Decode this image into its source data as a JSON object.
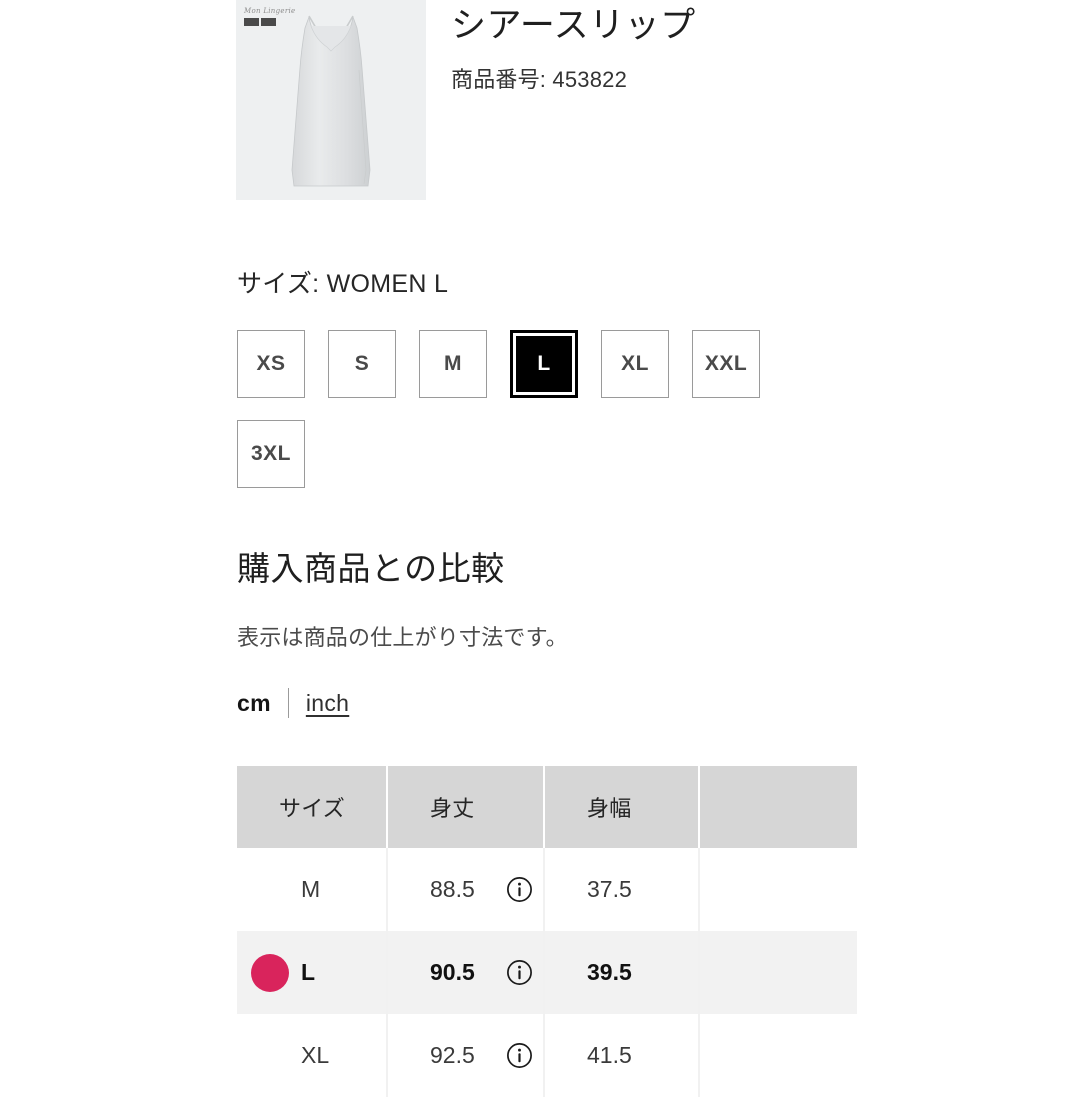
{
  "product": {
    "title": "シアースリップ",
    "code_label": "商品番号: 453822",
    "thumbnail": {
      "watermark_script": "Mon Lingerie",
      "alt": "sheer slip dress"
    }
  },
  "size_selection": {
    "label": "サイズ: WOMEN L",
    "selected": "L",
    "options": [
      {
        "label": "XS",
        "selected": false
      },
      {
        "label": "S",
        "selected": false
      },
      {
        "label": "M",
        "selected": false
      },
      {
        "label": "L",
        "selected": true
      },
      {
        "label": "XL",
        "selected": false
      },
      {
        "label": "XXL",
        "selected": false
      },
      {
        "label": "3XL",
        "selected": false
      }
    ]
  },
  "comparison": {
    "heading": "購入商品との比較",
    "note": "表示は商品の仕上がり寸法です。",
    "units": {
      "cm_label": "cm",
      "inch_label": "inch",
      "active": "cm"
    },
    "table": {
      "headers": [
        "サイズ",
        "身丈",
        "身幅",
        ""
      ],
      "info_icon": "info-icon",
      "rows": [
        {
          "size": "M",
          "length": "88.5",
          "width": "37.5",
          "extra": "",
          "highlighted": false,
          "has_dot": false
        },
        {
          "size": "L",
          "length": "90.5",
          "width": "39.5",
          "extra": "",
          "highlighted": true,
          "has_dot": true
        },
        {
          "size": "XL",
          "length": "92.5",
          "width": "41.5",
          "extra": "",
          "highlighted": false,
          "has_dot": false
        }
      ]
    }
  },
  "colors": {
    "dot_accent": "#d9245c",
    "header_bg": "#d6d6d6",
    "highlight_row_bg": "#f2f2f2",
    "selected_size_bg": "#000000"
  }
}
